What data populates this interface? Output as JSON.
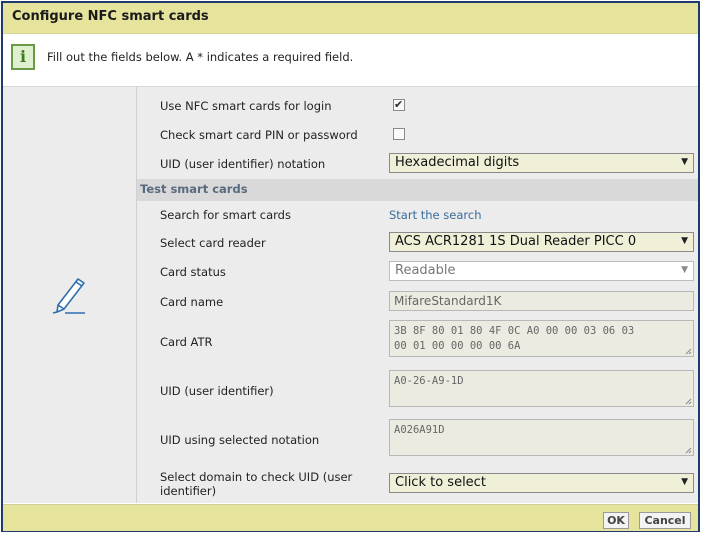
{
  "dialog": {
    "title": "Configure NFC smart cards",
    "info_text": "Fill out the fields below. A * indicates a required field.",
    "info_icon": "info-icon"
  },
  "settings": {
    "use_nfc_label": "Use NFC smart cards for login",
    "use_nfc_checked": true,
    "check_pin_label": "Check smart card PIN or password",
    "check_pin_checked": false,
    "uid_notation_label": "UID (user identifier) notation",
    "uid_notation_value": "Hexadecimal digits"
  },
  "test": {
    "section_title": "Test smart cards",
    "search_label": "Search for smart cards",
    "search_link": "Start the search",
    "reader_label": "Select card reader",
    "reader_value": "ACS ACR1281 1S Dual Reader PICC 0",
    "status_label": "Card status",
    "status_value": "Readable",
    "name_label": "Card name",
    "name_value": "MifareStandard1K",
    "atr_label": "Card ATR",
    "atr_value": "3B 8F 80 01 80 4F 0C A0 00 00 03 06 03\n00 01 00 00 00 00 6A",
    "uid_label": "UID (user identifier)",
    "uid_value": "A0-26-A9-1D",
    "uid_sel_label": "UID using selected notation",
    "uid_sel_value": "A026A91D",
    "domain_label": "Select domain to check UID (user identifier)",
    "domain_value": "Click to select"
  },
  "footer": {
    "ok_label": "OK",
    "cancel_label": "Cancel"
  },
  "colors": {
    "titlebar_bg": "#e5e39c",
    "border": "#1f3a6e",
    "link": "#3a6a9a",
    "section_text": "#5a6a7e"
  }
}
